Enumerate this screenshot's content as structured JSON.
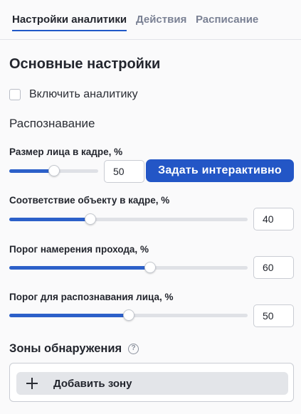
{
  "tabs": [
    {
      "label": "Настройки аналитики",
      "active": true
    },
    {
      "label": "Действия",
      "active": false
    },
    {
      "label": "Расписание",
      "active": false
    }
  ],
  "section_title": "Основные настройки",
  "enable_analytics": {
    "label": "Включить аналитику",
    "checked": false
  },
  "recognition_heading": "Распознавание",
  "face_size": {
    "label": "Размер лица в кадре, %",
    "value": "50",
    "slider_fraction": 0.5
  },
  "interactive_button": "Задать интерактивно",
  "object_match": {
    "label": "Соответствие объекту в кадре, %",
    "value": "40",
    "slider_fraction": 0.34
  },
  "pass_intent": {
    "label": "Порог намерения прохода, %",
    "value": "60",
    "slider_fraction": 0.59
  },
  "face_threshold": {
    "label": "Порог для распознавания лица, %",
    "value": "50",
    "slider_fraction": 0.5
  },
  "zones": {
    "title": "Зоны обнаружения",
    "help_icon": "?",
    "add_label": "Добавить зону"
  },
  "colors": {
    "accent": "#2356c6",
    "slider_fill": "#2c60c9",
    "track": "#dfe1e6"
  }
}
